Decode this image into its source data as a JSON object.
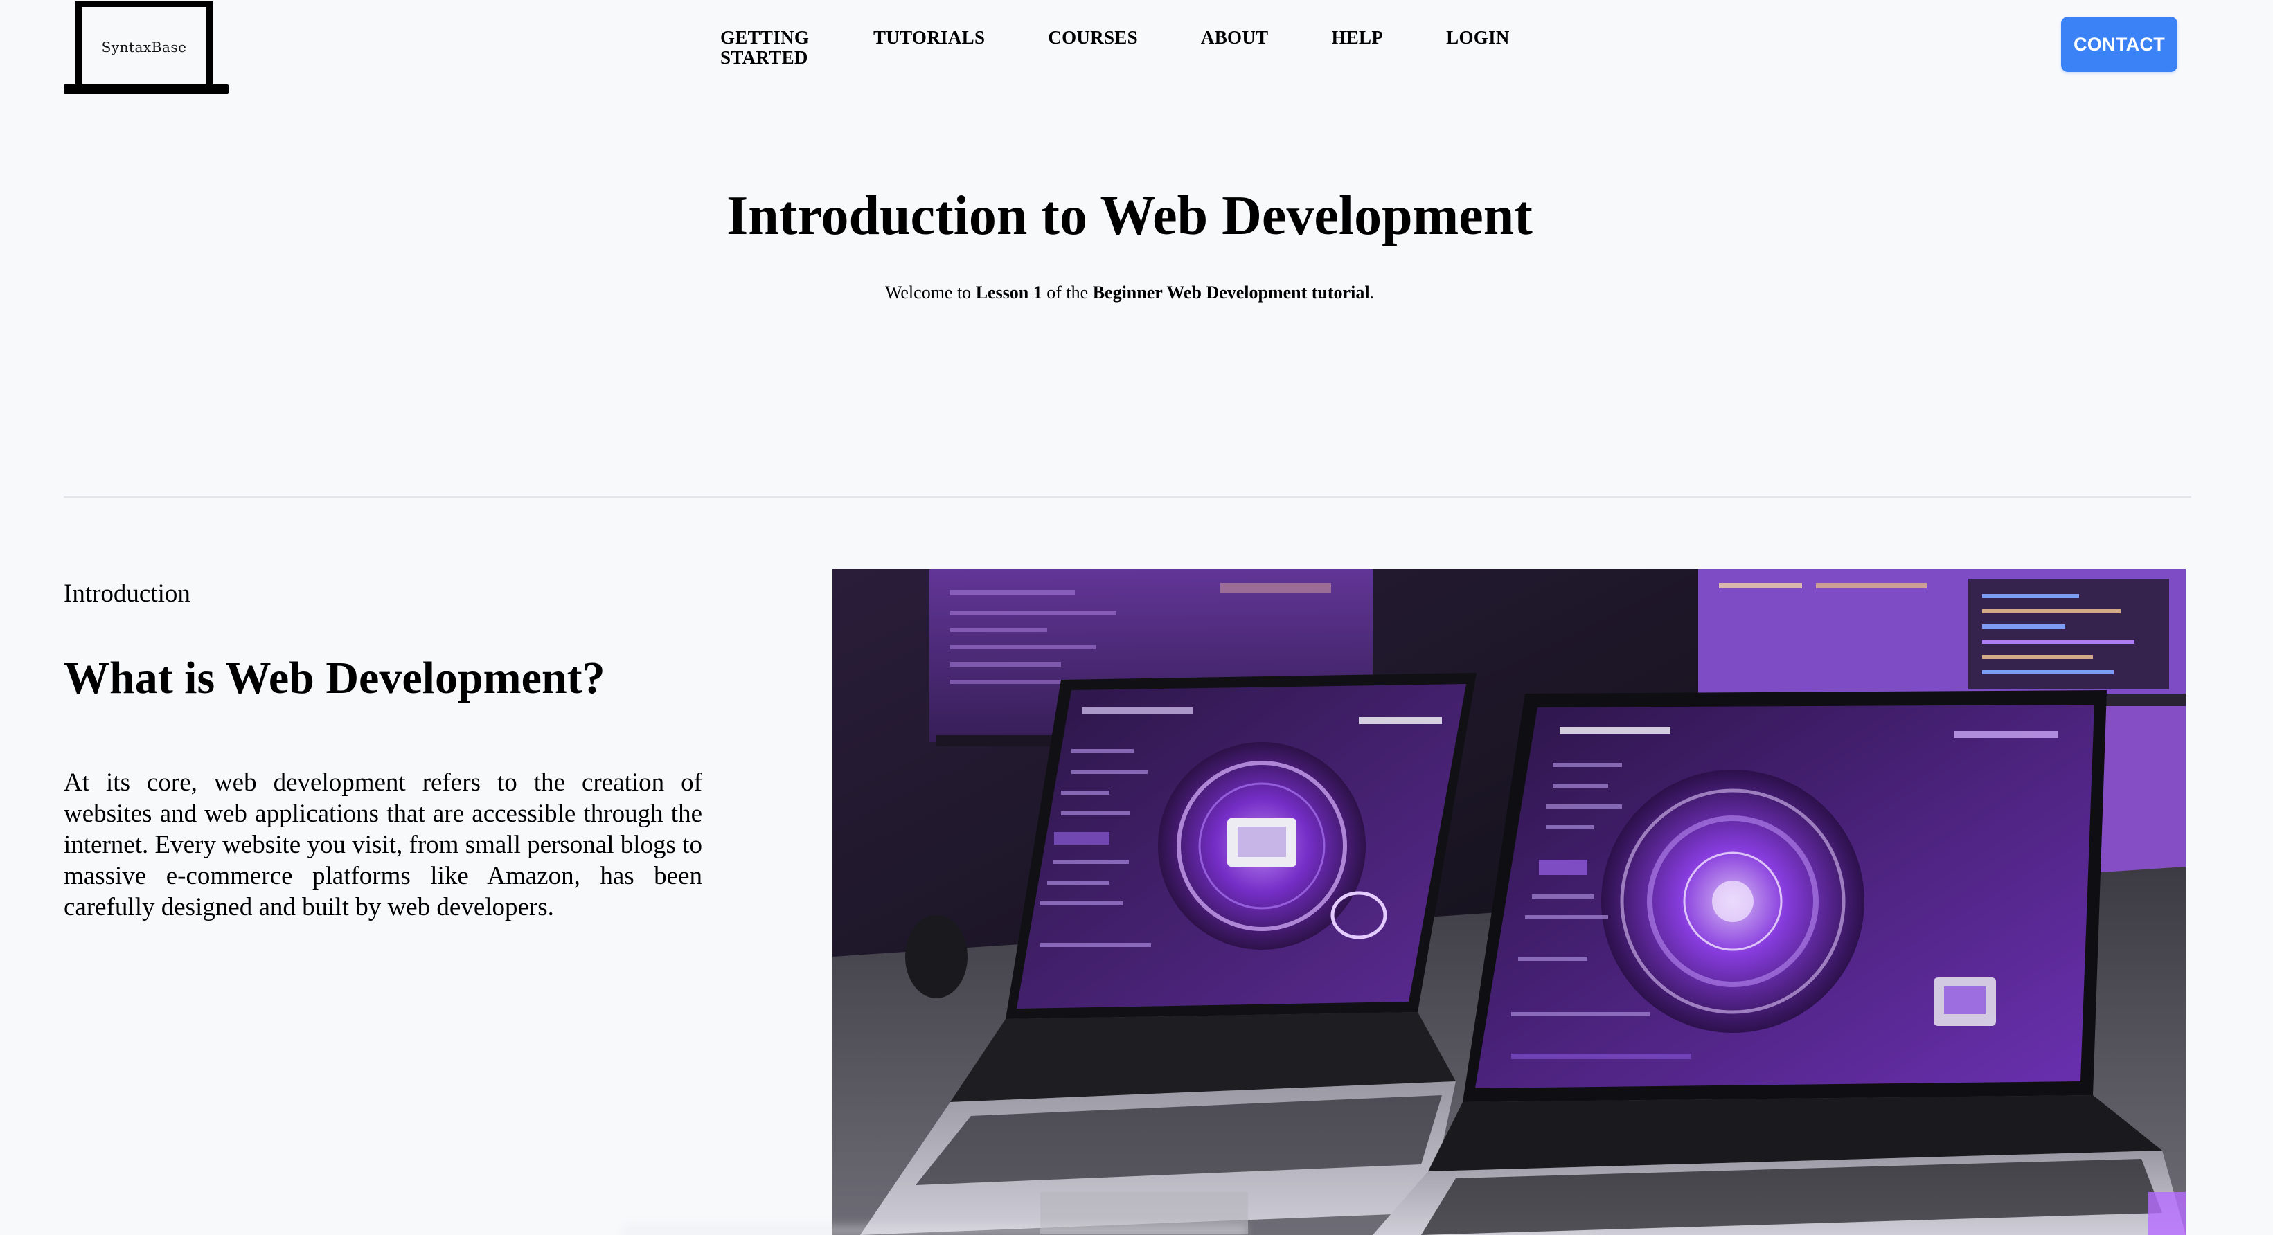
{
  "logo": {
    "text": "SyntaxBase"
  },
  "nav": {
    "items": [
      {
        "label": "GETTING STARTED"
      },
      {
        "label": "TUTORIALS"
      },
      {
        "label": "COURSES"
      },
      {
        "label": "ABOUT"
      },
      {
        "label": "HELP"
      },
      {
        "label": "LOGIN"
      }
    ],
    "contact_label": "CONTACT"
  },
  "hero": {
    "title": "Introduction to Web Development",
    "subtitle": {
      "prefix": "Welcome to ",
      "lesson": "Lesson 1",
      "middle": " of the ",
      "tutorial": "Beginner Web Development tutorial",
      "suffix": "."
    }
  },
  "intro": {
    "label": "Introduction",
    "heading": "What is Web Development?",
    "body": "At its core, web development refers to the creation of websites and web applications that are accessible through the internet. Every website you visit, from small personal blogs to massive e-commerce platforms like Amazon, has been carefully designed and built by web developers."
  },
  "colors": {
    "accent": "#3b82f6",
    "background": "#f8f9fb",
    "text": "#000000",
    "image_purple": "#8b3fd9"
  },
  "icons": {
    "logo": "laptop-logo-icon"
  }
}
